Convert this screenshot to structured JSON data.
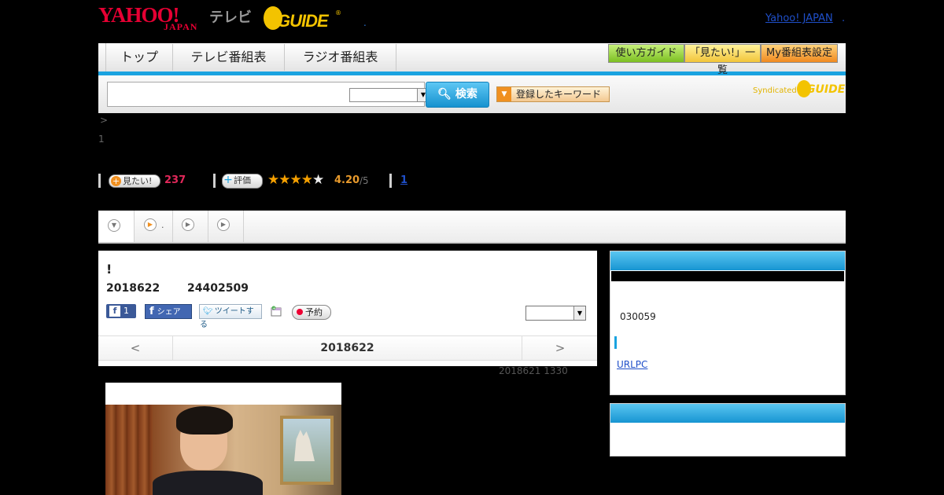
{
  "header": {
    "logo_yahoo": "YAHOO!",
    "logo_japan": "JAPAN",
    "logo_tv": "テレビ",
    "logo_guide": "GUIDE",
    "logo_reg": "®",
    "dot": ".",
    "yahoo_japan_link": "Yahoo! JAPAN",
    "right_dot": "."
  },
  "nav": {
    "tabs": [
      "トップ",
      "テレビ番組表",
      "ラジオ番組表"
    ],
    "guide_buttons": [
      "使い方ガイド",
      "「見たい!」一覧",
      "My番組表設定"
    ],
    "guide_colors": [
      "#8ccc30",
      "#f6d24a",
      "#f2a33a"
    ]
  },
  "search": {
    "input_value": "",
    "select_value": "",
    "button_label": "検索",
    "keyword_button": "登録したキーワード",
    "syndicated": "Syndicated",
    "syndicated_logo": "GUIDE"
  },
  "breadcrumb": {
    "separator": ">",
    "page": "1"
  },
  "stats": {
    "want_label": "見たい!",
    "want_count": "237",
    "rate_label": "評価",
    "stars": 4,
    "rating": "4.20",
    "rating_max": "/5",
    "review_link": "1"
  },
  "tabs_strip": {
    "items": [
      "",
      ".",
      "",
      ""
    ]
  },
  "program": {
    "title": "!",
    "date": "2018622",
    "time": "24402509",
    "fb_like_count": "1",
    "fb_share": "シェア",
    "tweet": "ツイートする",
    "reserve": "予約",
    "select_value": "",
    "prev": "<",
    "current_date": "2018622",
    "next": ">",
    "updated": "2018621  1330"
  },
  "sidebar": {
    "code": "030059",
    "link": "URLPC"
  }
}
